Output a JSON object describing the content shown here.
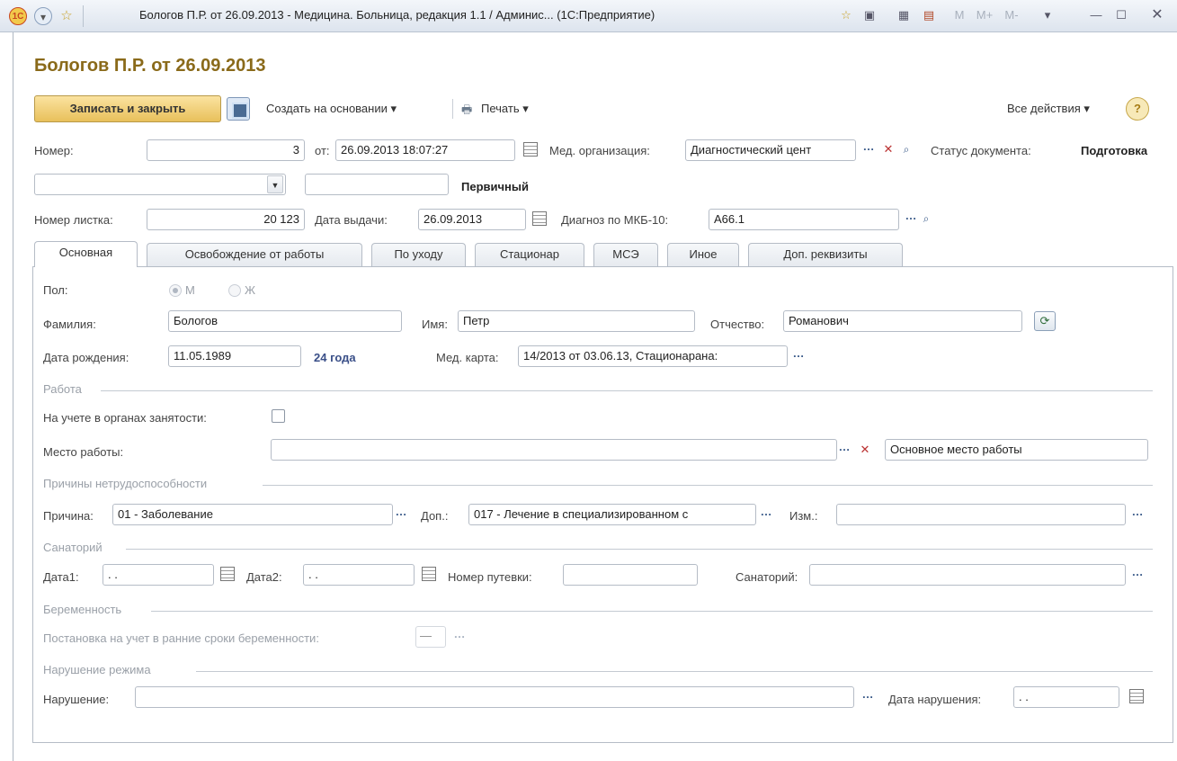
{
  "window": {
    "title": "Бологов П.Р. от 26.09.2013 - Медицина. Больница, редакция 1.1 / Админис... (1С:Предприятие)",
    "logo": "1С",
    "memo_buttons": [
      "M",
      "M+",
      "M-"
    ]
  },
  "document": {
    "title": "Бологов П.Р. от 26.09.2013"
  },
  "toolbar": {
    "save_close": "Записать и закрыть",
    "create_based": "Создать на основании ▾",
    "print": "Печать ▾",
    "all_actions": "Все действия ▾",
    "help": "?"
  },
  "header": {
    "number_label": "Номер:",
    "number_value": "3",
    "date_label": "от:",
    "date_value": "26.09.2013 18:07:27",
    "org_label": "Мед. организация:",
    "org_value": "Диагностический цент",
    "status_label": "Статус документа:",
    "status_value": "Подготовка",
    "type_value": "",
    "primary_text": "Первичный",
    "sheet_label": "Номер листка:",
    "sheet_value": "20 123",
    "issue_label": "Дата выдачи:",
    "issue_value": "26.09.2013",
    "diag_label": "Диагноз по МКБ-10:",
    "diag_value": "A66.1"
  },
  "tabs": [
    "Основная",
    "Освобождение от работы",
    "По уходу",
    "Стационар",
    "МСЭ",
    "Иное",
    "Доп. реквизиты"
  ],
  "main": {
    "sex_label": "Пол:",
    "sex_m": "М",
    "sex_f": "Ж",
    "surname_label": "Фамилия:",
    "surname_value": "Бологов",
    "name_label": "Имя:",
    "name_value": "Петр",
    "patronymic_label": "Отчество:",
    "patronymic_value": "Романович",
    "birth_label": "Дата рождения:",
    "birth_value": "11.05.1989",
    "age_text": "24 года",
    "card_label": "Мед. карта:",
    "card_value": "14/2013 от 03.06.13, Стационарана:",
    "work_group": "Работа",
    "employment_label": "На учете в органах занятости:",
    "workplace_label": "Место работы:",
    "workplace_value": "",
    "workplace_type": "Основное место работы",
    "reasons_group": "Причины нетрудоспособности",
    "reason_label": "Причина:",
    "reason_value": "01 - Заболевание",
    "extra_label": "Доп.:",
    "extra_value": "017 - Лечение в специализированном с",
    "change_label": "Изм.:",
    "change_value": "",
    "sanatorium_group": "Санаторий",
    "date1_label": "Дата1:",
    "date1_value": ". .",
    "date2_label": "Дата2:",
    "date2_value": ". .",
    "voucher_label": "Номер путевки:",
    "voucher_value": "",
    "sanatorium_label": "Санаторий:",
    "sanatorium_value": "",
    "pregnancy_group": "Беременность",
    "early_label": "Постановка на учет в ранние сроки беременности:",
    "early_value": "—",
    "violation_group": "Нарушение режима",
    "violation_label": "Нарушение:",
    "violation_value": "",
    "violation_date_label": "Дата нарушения:",
    "violation_date_value": ". ."
  }
}
